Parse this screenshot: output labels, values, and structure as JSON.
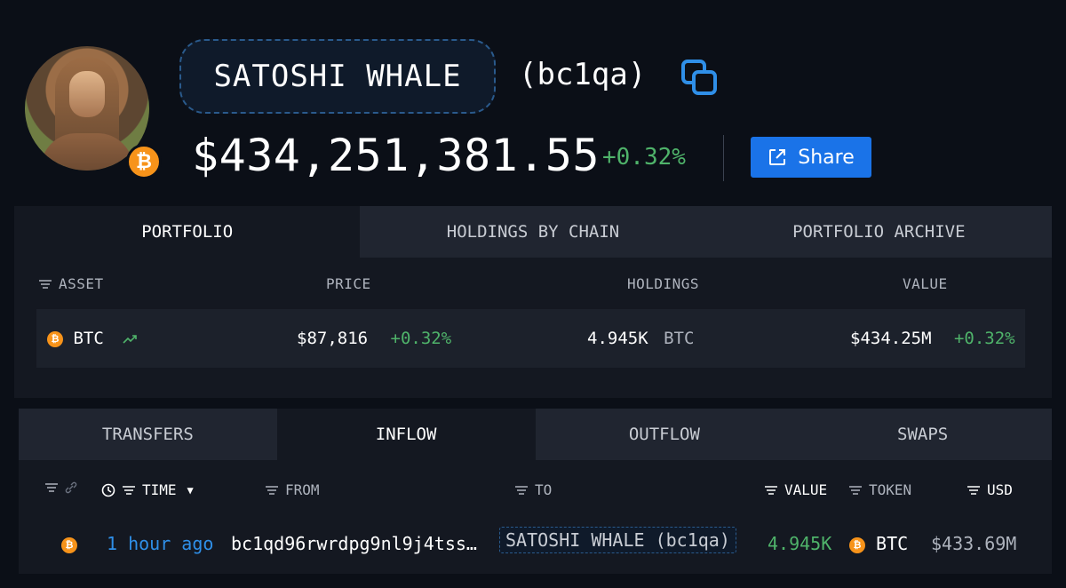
{
  "profile": {
    "name": "SATOSHI WHALE",
    "address": "(bc1qa)",
    "balance": "$434,251,381.55",
    "change": "+0.32%",
    "share_label": "Share"
  },
  "portfolio_tabs": [
    "PORTFOLIO",
    "HOLDINGS BY CHAIN",
    "PORTFOLIO ARCHIVE"
  ],
  "portfolio_columns": {
    "asset": "ASSET",
    "price": "PRICE",
    "holdings": "HOLDINGS",
    "value": "VALUE"
  },
  "portfolio_row": {
    "symbol": "BTC",
    "price": "$87,816",
    "price_change": "+0.32%",
    "holdings_amount": "4.945K",
    "holdings_unit": "BTC",
    "value": "$434.25M",
    "value_change": "+0.32%"
  },
  "transfer_tabs": [
    "TRANSFERS",
    "INFLOW",
    "OUTFLOW",
    "SWAPS"
  ],
  "transfer_columns": {
    "time": "TIME",
    "from": "FROM",
    "to": "TO",
    "value": "VALUE",
    "token": "TOKEN",
    "usd": "USD"
  },
  "transfer_row": {
    "time": "1 hour ago",
    "from": "bc1qd96rwrdpg9nl9j4tss…",
    "to": "SATOSHI WHALE (bc1qa)",
    "value": "4.945K",
    "token": "BTC",
    "usd": "$433.69M"
  },
  "colors": {
    "accent": "#1a73e8",
    "positive": "#4fb36a",
    "bitcoin": "#f7931a",
    "link": "#2f8fe8"
  }
}
